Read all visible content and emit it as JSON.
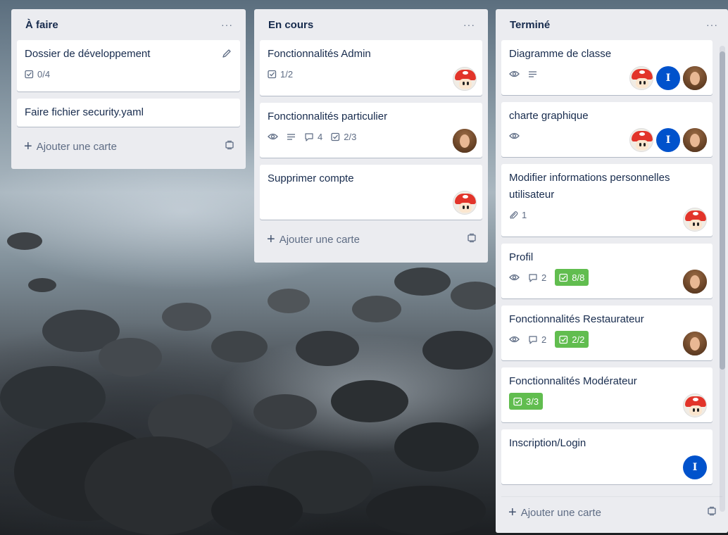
{
  "lists": [
    {
      "title": "À faire",
      "menu": "···",
      "add_card": "Ajouter une carte",
      "cards": [
        {
          "title": "Dossier de développement",
          "checklist": "0/4"
        },
        {
          "title": "Faire fichier security.yaml"
        }
      ]
    },
    {
      "title": "En cours",
      "menu": "···",
      "add_card": "Ajouter une carte",
      "cards": [
        {
          "title": "Fonctionnalités Admin",
          "checklist": "1/2",
          "members": [
            "mushroom"
          ]
        },
        {
          "title": "Fonctionnalités particulier",
          "watch": true,
          "description": true,
          "comments": "4",
          "checklist": "2/3",
          "members": [
            "girl"
          ]
        },
        {
          "title": "Supprimer compte",
          "members": [
            "mushroom"
          ]
        }
      ]
    },
    {
      "title": "Terminé",
      "menu": "···",
      "add_card": "Ajouter une carte",
      "cards": [
        {
          "title": "Diagramme de classe",
          "watch": true,
          "description": true,
          "members": [
            "mushroom",
            "I",
            "girl"
          ]
        },
        {
          "title": "charte graphique",
          "watch": true,
          "members": [
            "mushroom",
            "I",
            "girl"
          ]
        },
        {
          "title": "Modifier informations personnelles utilisateur",
          "attachments": "1",
          "members": [
            "mushroom"
          ]
        },
        {
          "title": "Profil",
          "watch": true,
          "comments": "2",
          "checklist_done": "8/8",
          "members": [
            "girl"
          ]
        },
        {
          "title": "Fonctionnalités Restaurateur",
          "watch": true,
          "comments": "2",
          "checklist_done": "2/2",
          "members": [
            "girl"
          ]
        },
        {
          "title": "Fonctionnalités Modérateur",
          "checklist_done": "3/3",
          "members": [
            "mushroom"
          ]
        },
        {
          "title": "Inscription/Login",
          "members": [
            "I"
          ]
        }
      ]
    }
  ],
  "colors": {
    "list_bg": "#ebecf0",
    "card_bg": "#ffffff",
    "text": "#172b4d",
    "muted": "#5e6c84",
    "done_badge": "#61bd4f",
    "member_letter_bg": "#0052cc"
  },
  "icons": [
    "edit-icon",
    "checklist-icon",
    "eye-icon",
    "description-icon",
    "comment-icon",
    "attachment-icon",
    "plus-icon",
    "card-template-icon",
    "more-icon"
  ]
}
